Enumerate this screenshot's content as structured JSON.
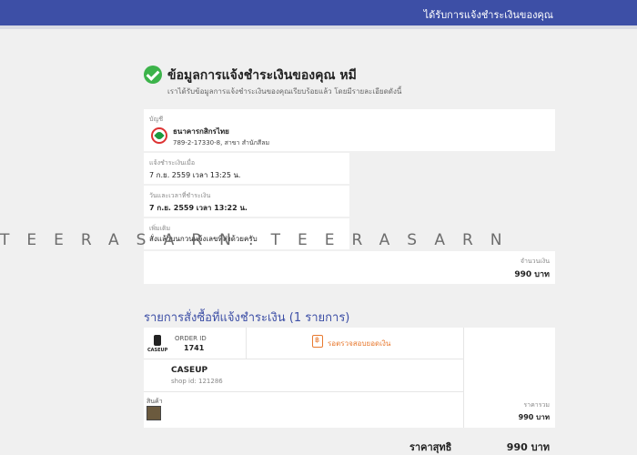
{
  "topbar": {
    "title": "ได้รับการแจ้งชำระเงินของคุณ"
  },
  "header": {
    "title": "ข้อมูลการแจ้งชำระเงินของคุณ หมี",
    "subtitle": "เราได้รับข้อมูลการแจ้งชำระเงินของคุณเรียบร้อยแล้ว โดยมีรายละเอียดดังนี้"
  },
  "account": {
    "label": "บัญชี",
    "bank_name": "ธนาคารกสิกรไทย",
    "account_info": "789-2-17330-8, สาขา สำนักสีลม"
  },
  "notified": {
    "label": "แจ้งชำระเงินเมื่อ",
    "value": "7 ก.ย. 2559 เวลา 13:25 น."
  },
  "paid": {
    "label": "วันและเวลาที่ชำระเงิน",
    "value": "7 ก.ย. 2559 เวลา 13:22 น."
  },
  "extra": {
    "label": "เพิ่มเติม",
    "value": "สั่งแล้วบนกวนแจ้งเลขที่ส่งด้วยครับ"
  },
  "amount": {
    "label": "จำนวนเงิน",
    "value": "990 บาท"
  },
  "orders_section": {
    "title": "รายการสั่งซื้อที่แจ้งชำระเงิน (1 รายการ)"
  },
  "order": {
    "id_label": "ORDER ID",
    "id_value": "1741",
    "status": "รอตรวจสอบยอดเงิน",
    "shop_name": "CASEUP",
    "shop_id": "shop id: 121286",
    "shop_logo_text": "CASEUP",
    "product_label": "สินค้า",
    "subtotal_label": "ราคารวม",
    "subtotal_value": "990 บาท"
  },
  "total": {
    "label": "ราคาสุทธิ",
    "value": "990 บาท"
  },
  "watermark": {
    "text": "TEERASARN:TEERASARN"
  }
}
